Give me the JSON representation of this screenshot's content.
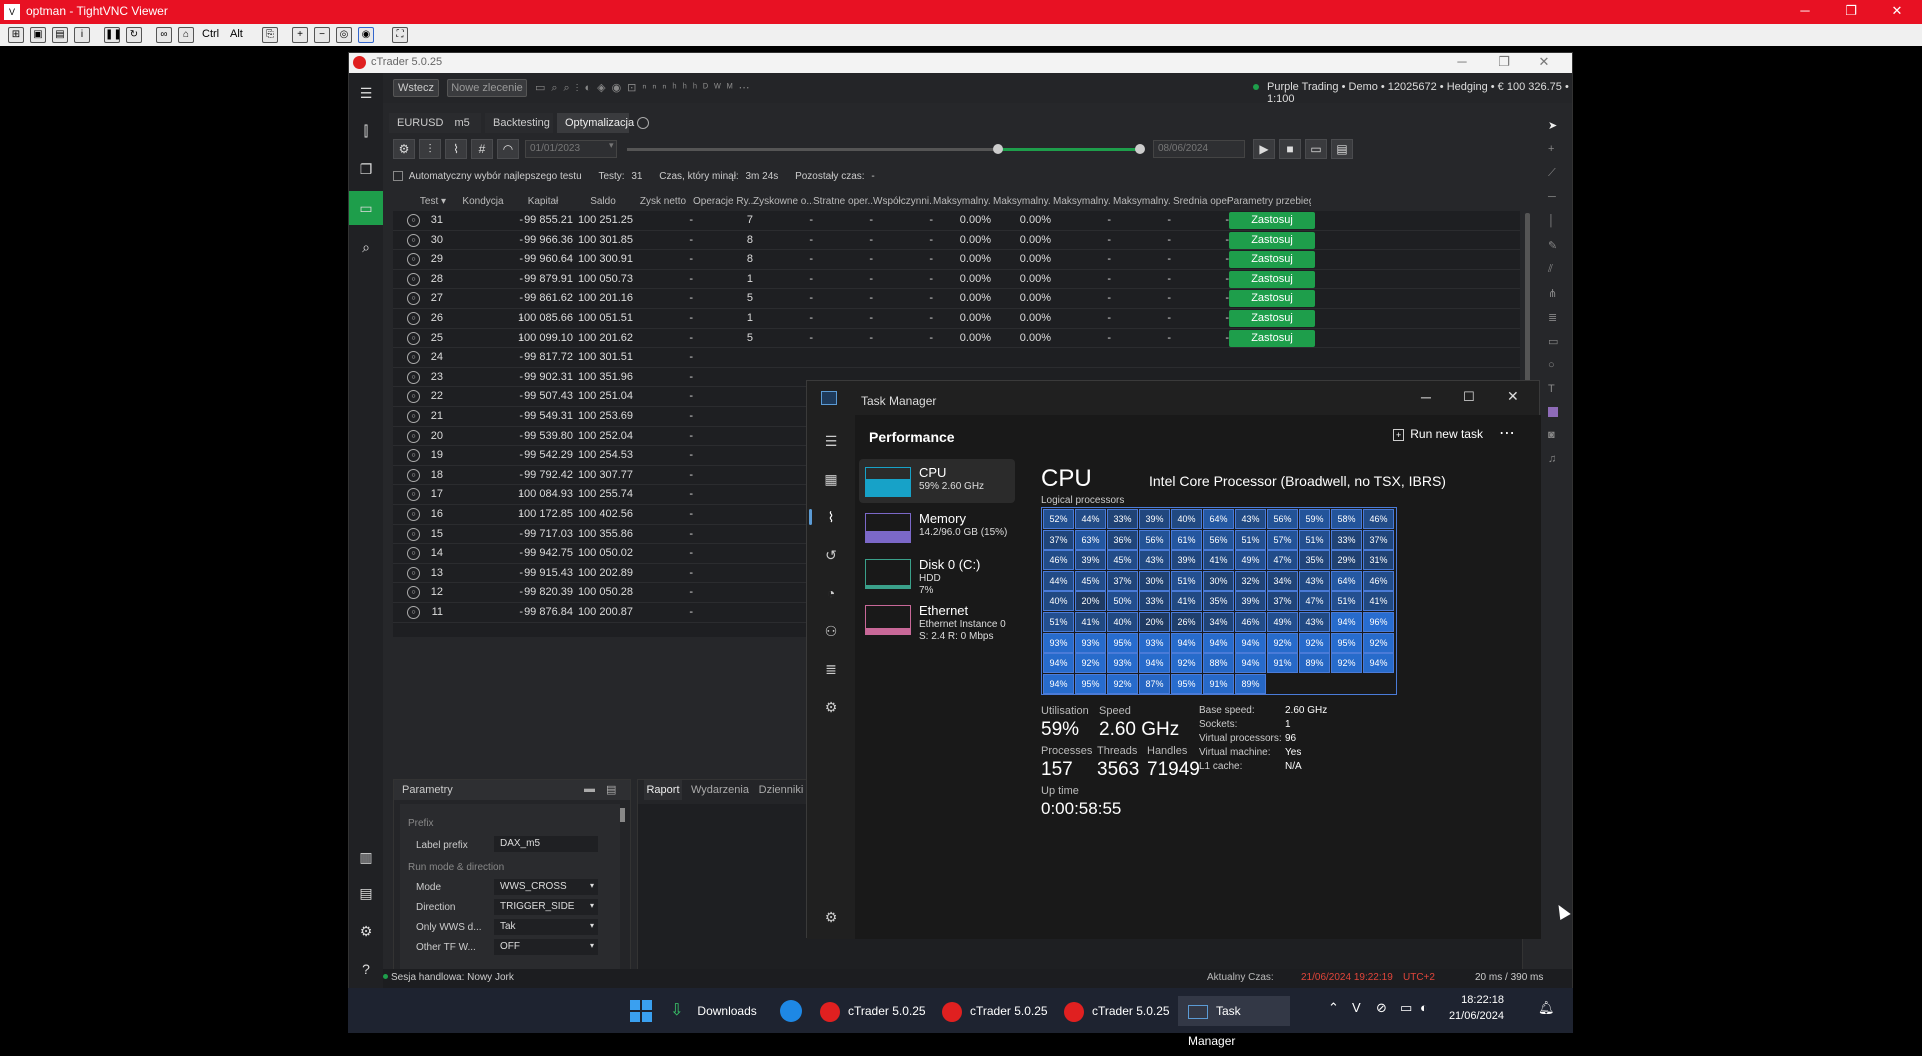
{
  "vnc": {
    "title": "optman - TightVNC Viewer",
    "ctrl": "Ctrl",
    "alt": "Alt"
  },
  "ctrader": {
    "title": "cTrader 5.0.25",
    "back": "Wstecz",
    "new_order": "Nowe zlecenie",
    "account": "Purple Trading • Demo • 12025672 • Hedging • € 100 326.75 • 1:100",
    "symbol": "EURUSD",
    "timeframe": "m5",
    "tabs": [
      "Backtesting",
      "Optymalizacja"
    ],
    "date_start": "01/01/2023",
    "date_end": "08/06/2024",
    "auto_select": "Automatyczny wybór najlepszego testu",
    "tests_label": "Testy:",
    "tests": "31",
    "elapsed_label": "Czas, który minął:",
    "elapsed": "3m 24s",
    "remaining_label": "Pozostały czas:",
    "remaining": "-",
    "columns": [
      "Test ▾",
      "Kondycja",
      "Kapitał",
      "Saldo",
      "Zysk netto",
      "Operacje Ry...",
      "Zyskowne o...",
      "Stratne oper...",
      "Współczynni...",
      "Maksymalny...",
      "Maksymalny...",
      "Maksymalny...",
      "Maksymalny...",
      "Średnia oper...",
      "Parametry przebiegu"
    ],
    "apply_label": "Zastosuj",
    "rows": [
      {
        "test": "31",
        "kond": "-",
        "kap": "99 855.21",
        "saldo": "100 251.25",
        "zysk": "-",
        "ops": "7",
        "z": "-",
        "s": "-",
        "w": "-",
        "m1": "0.00%",
        "m2": "0.00%",
        "m3": "-",
        "m4": "-",
        "sr": "-",
        "apply": true
      },
      {
        "test": "30",
        "kond": "-",
        "kap": "99 966.36",
        "saldo": "100 301.85",
        "zysk": "-",
        "ops": "8",
        "z": "-",
        "s": "-",
        "w": "-",
        "m1": "0.00%",
        "m2": "0.00%",
        "m3": "-",
        "m4": "-",
        "sr": "-",
        "apply": true
      },
      {
        "test": "29",
        "kond": "-",
        "kap": "99 960.64",
        "saldo": "100 300.91",
        "zysk": "-",
        "ops": "8",
        "z": "-",
        "s": "-",
        "w": "-",
        "m1": "0.00%",
        "m2": "0.00%",
        "m3": "-",
        "m4": "-",
        "sr": "-",
        "apply": true
      },
      {
        "test": "28",
        "kond": "-",
        "kap": "99 879.91",
        "saldo": "100 050.73",
        "zysk": "-",
        "ops": "1",
        "z": "-",
        "s": "-",
        "w": "-",
        "m1": "0.00%",
        "m2": "0.00%",
        "m3": "-",
        "m4": "-",
        "sr": "-",
        "apply": true
      },
      {
        "test": "27",
        "kond": "-",
        "kap": "99 861.62",
        "saldo": "100 201.16",
        "zysk": "-",
        "ops": "5",
        "z": "-",
        "s": "-",
        "w": "-",
        "m1": "0.00%",
        "m2": "0.00%",
        "m3": "-",
        "m4": "-",
        "sr": "-",
        "apply": true
      },
      {
        "test": "26",
        "kond": "-",
        "kap": "100 085.66",
        "saldo": "100 051.51",
        "zysk": "-",
        "ops": "1",
        "z": "-",
        "s": "-",
        "w": "-",
        "m1": "0.00%",
        "m2": "0.00%",
        "m3": "-",
        "m4": "-",
        "sr": "-",
        "apply": true
      },
      {
        "test": "25",
        "kond": "-",
        "kap": "100 099.10",
        "saldo": "100 201.62",
        "zysk": "-",
        "ops": "5",
        "z": "-",
        "s": "-",
        "w": "-",
        "m1": "0.00%",
        "m2": "0.00%",
        "m3": "-",
        "m4": "-",
        "sr": "-",
        "apply": true
      },
      {
        "test": "24",
        "kond": "-",
        "kap": "99 817.72",
        "saldo": "100 301.51",
        "zysk": "-"
      },
      {
        "test": "23",
        "kond": "-",
        "kap": "99 902.31",
        "saldo": "100 351.96",
        "zysk": "-"
      },
      {
        "test": "22",
        "kond": "-",
        "kap": "99 507.43",
        "saldo": "100 251.04",
        "zysk": "-"
      },
      {
        "test": "21",
        "kond": "-",
        "kap": "99 549.31",
        "saldo": "100 253.69",
        "zysk": "-"
      },
      {
        "test": "20",
        "kond": "-",
        "kap": "99 539.80",
        "saldo": "100 252.04",
        "zysk": "-"
      },
      {
        "test": "19",
        "kond": "-",
        "kap": "99 542.29",
        "saldo": "100 254.53",
        "zysk": "-"
      },
      {
        "test": "18",
        "kond": "-",
        "kap": "99 792.42",
        "saldo": "100 307.77",
        "zysk": "-"
      },
      {
        "test": "17",
        "kond": "-",
        "kap": "100 084.93",
        "saldo": "100 255.74",
        "zysk": "-"
      },
      {
        "test": "16",
        "kond": "-",
        "kap": "100 172.85",
        "saldo": "100 402.56",
        "zysk": "-"
      },
      {
        "test": "15",
        "kond": "-",
        "kap": "99 717.03",
        "saldo": "100 355.86",
        "zysk": "-"
      },
      {
        "test": "14",
        "kond": "-",
        "kap": "99 942.75",
        "saldo": "100 050.02",
        "zysk": "-"
      },
      {
        "test": "13",
        "kond": "-",
        "kap": "99 915.43",
        "saldo": "100 202.89",
        "zysk": "-"
      },
      {
        "test": "12",
        "kond": "-",
        "kap": "99 820.39",
        "saldo": "100 050.28",
        "zysk": "-"
      },
      {
        "test": "11",
        "kond": "-",
        "kap": "99 876.84",
        "saldo": "100 200.87",
        "zysk": "-"
      }
    ],
    "params": {
      "title": "Parametry",
      "prefix_section": "Prefix",
      "label_prefix": "Label prefix",
      "label_prefix_val": "DAX_m5",
      "run_section": "Run mode & direction",
      "fields": [
        {
          "k": "Mode",
          "v": "WWS_CROSS"
        },
        {
          "k": "Direction",
          "v": "TRIGGER_SIDE"
        },
        {
          "k": "Only WWS d...",
          "v": "Tak"
        },
        {
          "k": "Other TF W...",
          "v": "OFF"
        }
      ]
    },
    "report_tabs": [
      "Raport",
      "Wydarzenia",
      "Dzienniki"
    ],
    "session": "Sesja handlowa: Nowy Jork",
    "time_label": "Aktualny Czas:",
    "time_value": "21/06/2024 19:22:19",
    "tz": "UTC+2",
    "latency": "20 ms / 390 ms"
  },
  "tm": {
    "title": "Task Manager",
    "section": "Performance",
    "run_new_task": "Run new task",
    "items": [
      {
        "name": "CPU",
        "l1": "59% 2.60 GHz",
        "l2": "",
        "l3": ""
      },
      {
        "name": "Memory",
        "l1": "14.2/96.0 GB (15%)",
        "l2": "",
        "l3": ""
      },
      {
        "name": "Disk 0 (C:)",
        "l1": "HDD",
        "l2": "7%",
        "l3": ""
      },
      {
        "name": "Ethernet",
        "l1": "Ethernet Instance 0",
        "l2": "S: 2.4 R: 0 Mbps",
        "l3": ""
      }
    ],
    "cpu_title": "CPU",
    "cpu_model": "Intel Core Processor (Broadwell, no TSX, IBRS)",
    "lp_label": "Logical processors",
    "lp": [
      "52%",
      "44%",
      "33%",
      "39%",
      "40%",
      "64%",
      "43%",
      "56%",
      "59%",
      "58%",
      "46%",
      "37%",
      "63%",
      "36%",
      "56%",
      "61%",
      "56%",
      "51%",
      "57%",
      "51%",
      "33%",
      "37%",
      "46%",
      "39%",
      "45%",
      "43%",
      "39%",
      "41%",
      "49%",
      "47%",
      "35%",
      "29%",
      "31%",
      "44%",
      "45%",
      "37%",
      "30%",
      "51%",
      "30%",
      "32%",
      "34%",
      "43%",
      "64%",
      "46%",
      "40%",
      "20%",
      "50%",
      "33%",
      "41%",
      "35%",
      "39%",
      "37%",
      "47%",
      "51%",
      "41%",
      "51%",
      "41%",
      "40%",
      "20%",
      "26%",
      "34%",
      "46%",
      "49%",
      "43%",
      "94%",
      "96%",
      "93%",
      "93%",
      "95%",
      "93%",
      "94%",
      "94%",
      "94%",
      "92%",
      "92%",
      "95%",
      "92%",
      "94%",
      "92%",
      "93%",
      "94%",
      "92%",
      "88%",
      "94%",
      "91%",
      "89%",
      "92%",
      "94%",
      "94%",
      "95%",
      "92%",
      "87%",
      "95%",
      "91%",
      "89%"
    ],
    "stats": {
      "util_l": "Utilisation",
      "util": "59%",
      "speed_l": "Speed",
      "speed": "2.60 GHz",
      "proc_l": "Processes",
      "proc": "157",
      "thr_l": "Threads",
      "thr": "3563",
      "hnd_l": "Handles",
      "hnd": "71949",
      "up_l": "Up time",
      "up": "0:00:58:55"
    },
    "specs": [
      {
        "k": "Base speed:",
        "v": "2.60 GHz"
      },
      {
        "k": "Sockets:",
        "v": "1"
      },
      {
        "k": "Virtual processors:",
        "v": "96"
      },
      {
        "k": "Virtual machine:",
        "v": "Yes"
      },
      {
        "k": "L1 cache:",
        "v": "N/A"
      }
    ]
  },
  "taskbar": {
    "items": [
      "Downloads",
      "cTrader 5.0.25",
      "cTrader 5.0.25",
      "cTrader 5.0.25",
      "Task Manager"
    ],
    "time": "18:22:18",
    "date": "21/06/2024"
  }
}
